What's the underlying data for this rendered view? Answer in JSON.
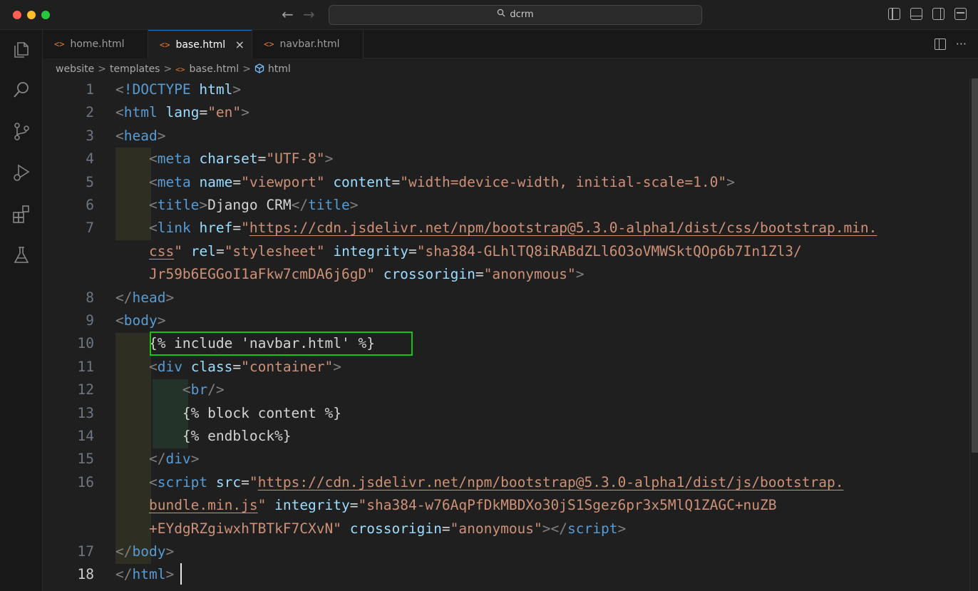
{
  "window": {
    "command_center": "dcrm",
    "back_arrow": "←",
    "forward_arrow": "→"
  },
  "tabs": [
    {
      "label": "home.html",
      "icon": "<>"
    },
    {
      "label": "base.html",
      "icon": "<>",
      "active": true
    },
    {
      "label": "navbar.html",
      "icon": "<>"
    }
  ],
  "tab_close": "×",
  "tab_more": "···",
  "breadcrumb": {
    "items": [
      "website",
      "templates",
      "base.html",
      "html"
    ],
    "separator": ">"
  },
  "editor": {
    "current_line": 18,
    "highlighted_line": 10,
    "line_numbers": [
      {
        "row": 0,
        "num": "1"
      },
      {
        "row": 1,
        "num": "2"
      },
      {
        "row": 2,
        "num": "3"
      },
      {
        "row": 3,
        "num": "4"
      },
      {
        "row": 4,
        "num": "5"
      },
      {
        "row": 5,
        "num": "6"
      },
      {
        "row": 6,
        "num": "7"
      },
      {
        "row": 9,
        "num": "8"
      },
      {
        "row": 10,
        "num": "9"
      },
      {
        "row": 11,
        "num": "10"
      },
      {
        "row": 12,
        "num": "11"
      },
      {
        "row": 13,
        "num": "12"
      },
      {
        "row": 14,
        "num": "13"
      },
      {
        "row": 15,
        "num": "14"
      },
      {
        "row": 16,
        "num": "15"
      },
      {
        "row": 17,
        "num": "16"
      },
      {
        "row": 20,
        "num": "17"
      },
      {
        "row": 21,
        "num": "18"
      }
    ],
    "rows": [
      [
        [
          "t",
          "<"
        ],
        [
          "n",
          "!DOCTYPE"
        ],
        [
          "w",
          " "
        ],
        [
          "a",
          "html"
        ],
        [
          "t",
          ">"
        ]
      ],
      [
        [
          "t",
          "<"
        ],
        [
          "n",
          "html"
        ],
        [
          "w",
          " "
        ],
        [
          "a",
          "lang"
        ],
        [
          "w",
          "="
        ],
        [
          "s",
          "\"en\""
        ],
        [
          "t",
          ">"
        ]
      ],
      [
        [
          "t",
          "<"
        ],
        [
          "n",
          "head"
        ],
        [
          "t",
          ">"
        ]
      ],
      [
        [
          "w",
          "    "
        ],
        [
          "t",
          "<"
        ],
        [
          "n",
          "meta"
        ],
        [
          "w",
          " "
        ],
        [
          "a",
          "charset"
        ],
        [
          "w",
          "="
        ],
        [
          "s",
          "\"UTF-8\""
        ],
        [
          "t",
          ">"
        ]
      ],
      [
        [
          "w",
          "    "
        ],
        [
          "t",
          "<"
        ],
        [
          "n",
          "meta"
        ],
        [
          "w",
          " "
        ],
        [
          "a",
          "name"
        ],
        [
          "w",
          "="
        ],
        [
          "s",
          "\"viewport\""
        ],
        [
          "w",
          " "
        ],
        [
          "a",
          "content"
        ],
        [
          "w",
          "="
        ],
        [
          "s",
          "\"width=device-width, initial-scale=1.0\""
        ],
        [
          "t",
          ">"
        ]
      ],
      [
        [
          "w",
          "    "
        ],
        [
          "t",
          "<"
        ],
        [
          "n",
          "title"
        ],
        [
          "t",
          ">"
        ],
        [
          "w",
          "Django CRM"
        ],
        [
          "t",
          "</"
        ],
        [
          "n",
          "title"
        ],
        [
          "t",
          ">"
        ]
      ],
      [
        [
          "w",
          "    "
        ],
        [
          "t",
          "<"
        ],
        [
          "n",
          "link"
        ],
        [
          "w",
          " "
        ],
        [
          "a",
          "href"
        ],
        [
          "w",
          "="
        ],
        [
          "s",
          "\""
        ],
        [
          "u",
          "https://cdn.jsdelivr.net/npm/bootstrap@5.3.0-alpha1/dist/css/bootstrap.min."
        ]
      ],
      [
        [
          "w",
          "    "
        ],
        [
          "u",
          "css"
        ],
        [
          "s",
          "\""
        ],
        [
          "w",
          " "
        ],
        [
          "a",
          "rel"
        ],
        [
          "w",
          "="
        ],
        [
          "s",
          "\"stylesheet\""
        ],
        [
          "w",
          " "
        ],
        [
          "a",
          "integrity"
        ],
        [
          "w",
          "="
        ],
        [
          "s",
          "\"sha384-GLhlTQ8iRABdZLl6O3oVMWSktQOp6b7In1Zl3/"
        ]
      ],
      [
        [
          "w",
          "    "
        ],
        [
          "s",
          "Jr59b6EGGoI1aFkw7cmDA6j6gD\""
        ],
        [
          "w",
          " "
        ],
        [
          "a",
          "crossorigin"
        ],
        [
          "w",
          "="
        ],
        [
          "s",
          "\"anonymous\""
        ],
        [
          "t",
          ">"
        ]
      ],
      [
        [
          "t",
          "</"
        ],
        [
          "n",
          "head"
        ],
        [
          "t",
          ">"
        ]
      ],
      [
        [
          "t",
          "<"
        ],
        [
          "n",
          "body"
        ],
        [
          "t",
          ">"
        ]
      ],
      [
        [
          "w",
          "    {% include 'navbar.html' %}"
        ]
      ],
      [
        [
          "w",
          "    "
        ],
        [
          "t",
          "<"
        ],
        [
          "n",
          "div"
        ],
        [
          "w",
          " "
        ],
        [
          "a",
          "class"
        ],
        [
          "w",
          "="
        ],
        [
          "s",
          "\"container\""
        ],
        [
          "t",
          ">"
        ]
      ],
      [
        [
          "w",
          "        "
        ],
        [
          "t",
          "<"
        ],
        [
          "n",
          "br"
        ],
        [
          "t",
          "/>"
        ]
      ],
      [
        [
          "w",
          "        {% block content %}"
        ]
      ],
      [
        [
          "w",
          "        {% endblock%}"
        ]
      ],
      [
        [
          "w",
          "    "
        ],
        [
          "t",
          "</"
        ],
        [
          "n",
          "div"
        ],
        [
          "t",
          ">"
        ]
      ],
      [
        [
          "w",
          "    "
        ],
        [
          "t",
          "<"
        ],
        [
          "n",
          "script"
        ],
        [
          "w",
          " "
        ],
        [
          "a",
          "src"
        ],
        [
          "w",
          "="
        ],
        [
          "s",
          "\""
        ],
        [
          "u",
          "https://cdn.jsdelivr.net/npm/bootstrap@5.3.0-alpha1/dist/js/bootstrap."
        ]
      ],
      [
        [
          "w",
          "    "
        ],
        [
          "u",
          "bundle.min.js"
        ],
        [
          "s",
          "\""
        ],
        [
          "w",
          " "
        ],
        [
          "a",
          "integrity"
        ],
        [
          "w",
          "="
        ],
        [
          "s",
          "\"sha384-w76AqPfDkMBDXo30jS1Sgez6pr3x5MlQ1ZAGC+nuZB"
        ]
      ],
      [
        [
          "w",
          "    "
        ],
        [
          "s",
          "+EYdgRZgiwxhTBTkF7CXvN\""
        ],
        [
          "w",
          " "
        ],
        [
          "a",
          "crossorigin"
        ],
        [
          "w",
          "="
        ],
        [
          "s",
          "\"anonymous\""
        ],
        [
          "t",
          "></"
        ],
        [
          "n",
          "script"
        ],
        [
          "t",
          ">"
        ]
      ],
      [
        [
          "t",
          "</"
        ],
        [
          "n",
          "body"
        ],
        [
          "t",
          ">"
        ]
      ],
      [
        [
          "t",
          "</"
        ],
        [
          "n",
          "html"
        ],
        [
          "t",
          ">"
        ]
      ]
    ]
  },
  "activity_icons": [
    "files-icon",
    "search-icon",
    "source-control-icon",
    "run-debug-icon",
    "extensions-icon",
    "testing-flask-icon"
  ]
}
